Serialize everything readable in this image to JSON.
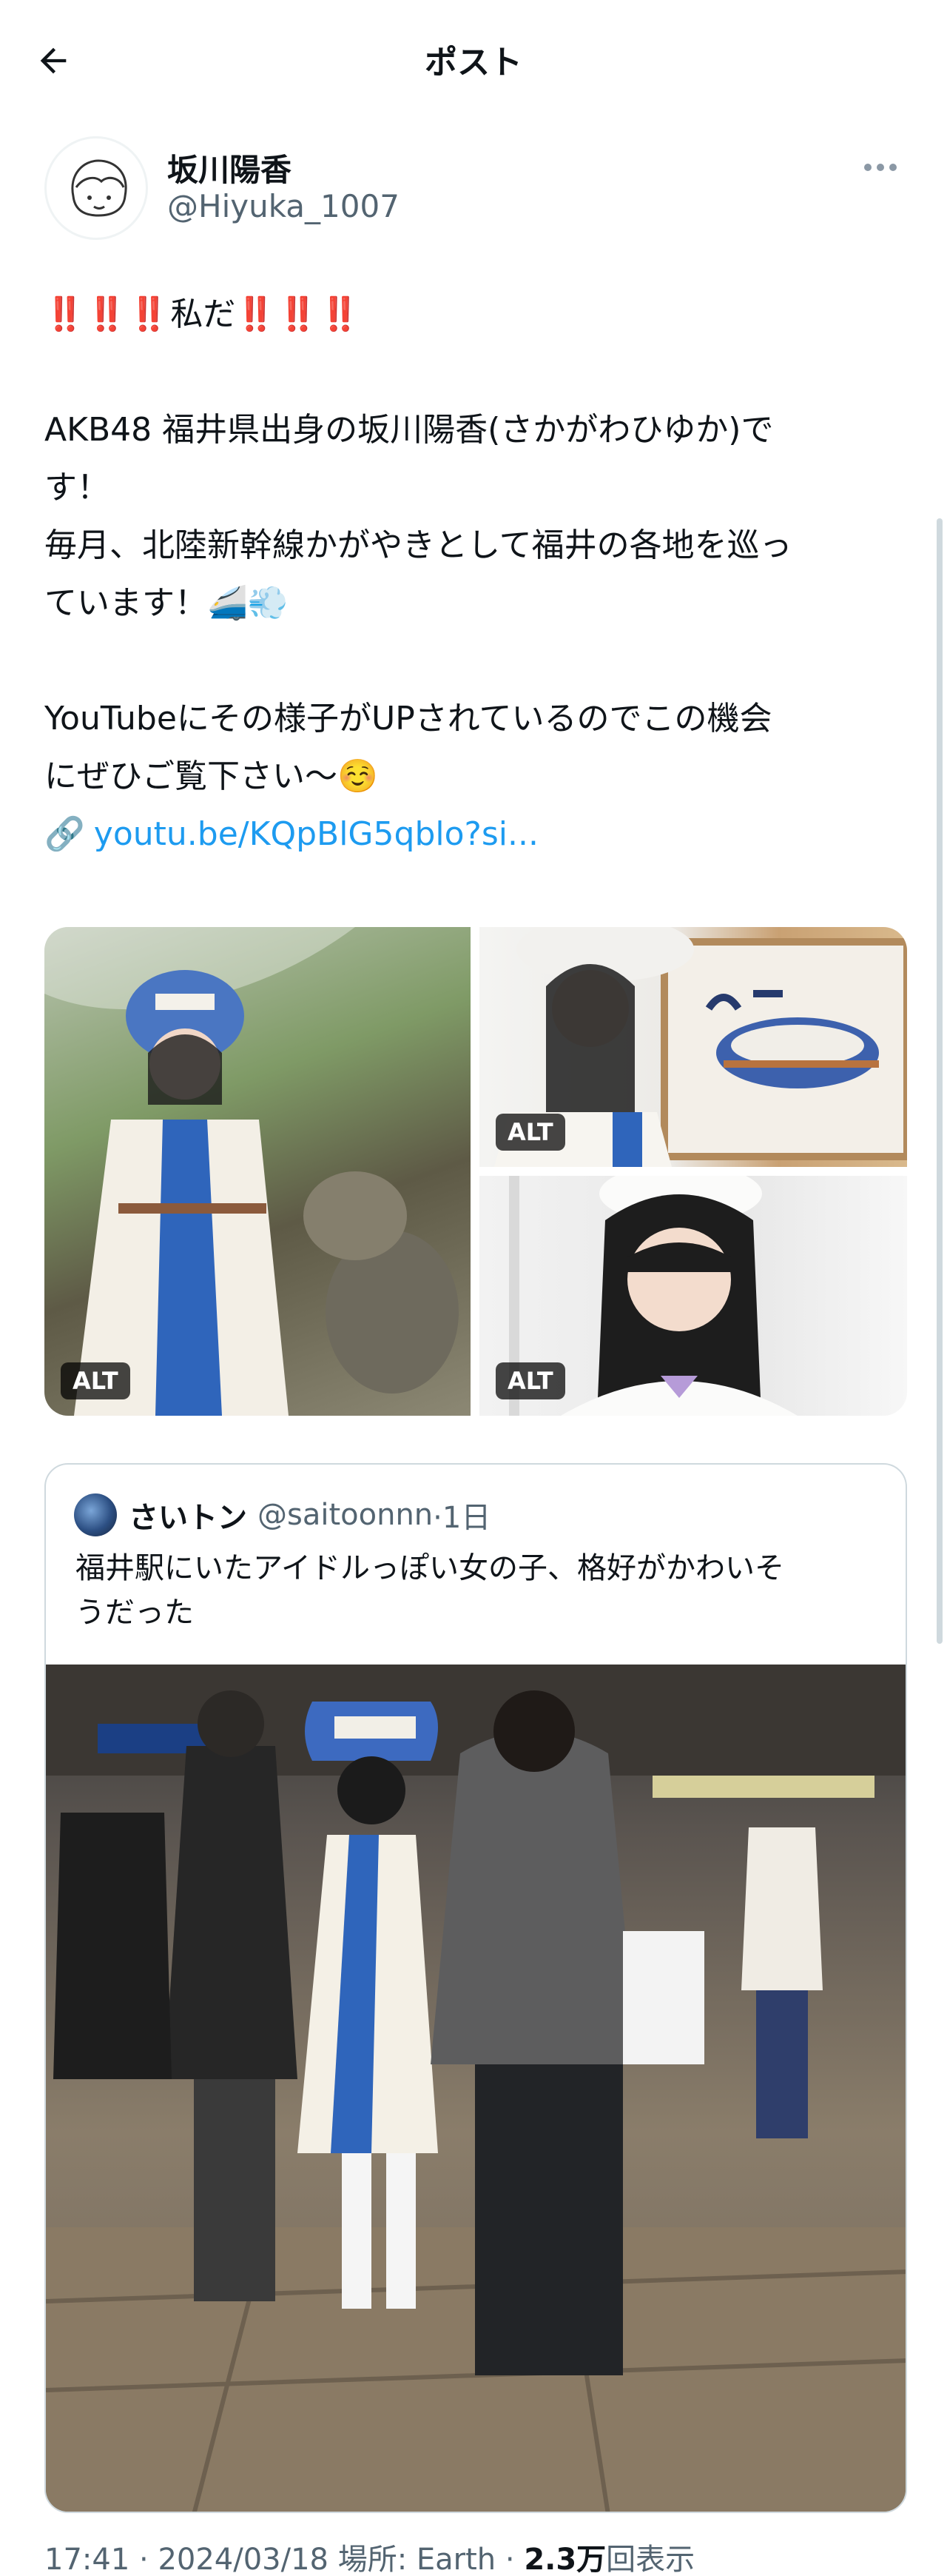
{
  "header": {
    "title": "ポスト"
  },
  "author": {
    "name": "坂川陽香",
    "handle": "@Hiyuka_1007"
  },
  "tweet": {
    "line1_bangs_left": "‼️‼️‼️",
    "line1_text": "私だ",
    "line1_bangs_right": "‼️‼️‼️",
    "line2": "AKB48 福井県出身の坂川陽香(さかがわひゆか)で",
    "line3": "す！",
    "line4": "毎月、北陸新幹線かがやきとして福井の各地を巡っ",
    "line5": "ています！🚄💨",
    "line6": "YouTubeにその様子がUPされているのでこの機会",
    "line7": "にぜひご覧下さい〜☺️",
    "link_icon": "🔗",
    "link": "youtu.be/KQpBlG5qblo?si..."
  },
  "media": {
    "alt_label": "ALT"
  },
  "quote": {
    "name": "さいトン",
    "handle": "@saitoonnn",
    "time": "·1日",
    "text_line1": "福井駅にいたアイドルっぽい女の子、格好がかわいそ",
    "text_line2": "うだった"
  },
  "meta": {
    "time": "17:41",
    "sep1": " · ",
    "date": "2024/03/18",
    "location": " 場所: Earth · ",
    "views_value": "2.3万",
    "views_label": "回表示"
  },
  "colors": {
    "accent": "#1d9bf0",
    "text": "#0f1419",
    "muted": "#536471",
    "border": "#cfd9de"
  }
}
